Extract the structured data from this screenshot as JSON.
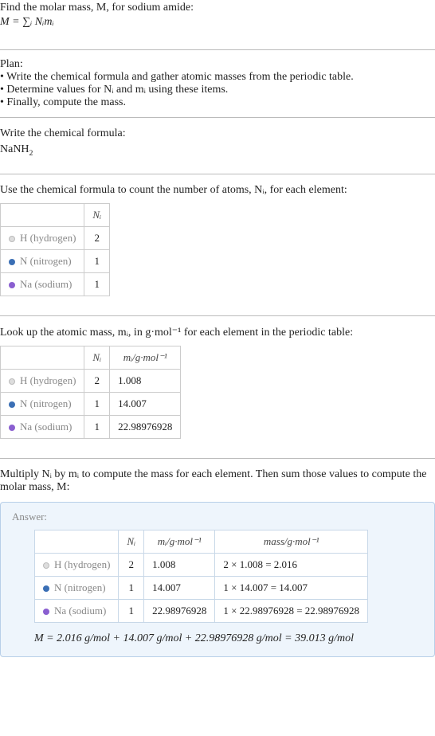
{
  "intro": {
    "line1": "Find the molar mass, M, for sodium amide:",
    "formula": "M = ∑ᵢ Nᵢmᵢ"
  },
  "plan": {
    "heading": "Plan:",
    "items": [
      "• Write the chemical formula and gather atomic masses from the periodic table.",
      "• Determine values for Nᵢ and mᵢ using these items.",
      "• Finally, compute the mass."
    ]
  },
  "step_formula": {
    "heading": "Write the chemical formula:",
    "formula_html": "NaNH",
    "formula_sub": "2"
  },
  "step_count": {
    "heading": "Use the chemical formula to count the number of atoms, Nᵢ, for each element:",
    "col_n": "Nᵢ",
    "rows": [
      {
        "dot": "dot-h",
        "name": "H (hydrogen)",
        "n": "2"
      },
      {
        "dot": "dot-n",
        "name": "N (nitrogen)",
        "n": "1"
      },
      {
        "dot": "dot-na",
        "name": "Na (sodium)",
        "n": "1"
      }
    ]
  },
  "step_mass": {
    "heading": "Look up the atomic mass, mᵢ, in g·mol⁻¹ for each element in the periodic table:",
    "col_n": "Nᵢ",
    "col_m": "mᵢ/g·mol⁻¹",
    "rows": [
      {
        "dot": "dot-h",
        "name": "H (hydrogen)",
        "n": "2",
        "m": "1.008"
      },
      {
        "dot": "dot-n",
        "name": "N (nitrogen)",
        "n": "1",
        "m": "14.007"
      },
      {
        "dot": "dot-na",
        "name": "Na (sodium)",
        "n": "1",
        "m": "22.98976928"
      }
    ]
  },
  "step_compute": {
    "heading": "Multiply Nᵢ by mᵢ to compute the mass for each element. Then sum those values to compute the molar mass, M:"
  },
  "answer": {
    "label": "Answer:",
    "col_n": "Nᵢ",
    "col_m": "mᵢ/g·mol⁻¹",
    "col_mass": "mass/g·mol⁻¹",
    "rows": [
      {
        "dot": "dot-h",
        "name": "H (hydrogen)",
        "n": "2",
        "m": "1.008",
        "mass": "2 × 1.008 = 2.016"
      },
      {
        "dot": "dot-n",
        "name": "N (nitrogen)",
        "n": "1",
        "m": "14.007",
        "mass": "1 × 14.007 = 14.007"
      },
      {
        "dot": "dot-na",
        "name": "Na (sodium)",
        "n": "1",
        "m": "22.98976928",
        "mass": "1 × 22.98976928 = 22.98976928"
      }
    ],
    "final": "M = 2.016 g/mol + 14.007 g/mol + 22.98976928 g/mol = 39.013 g/mol"
  }
}
